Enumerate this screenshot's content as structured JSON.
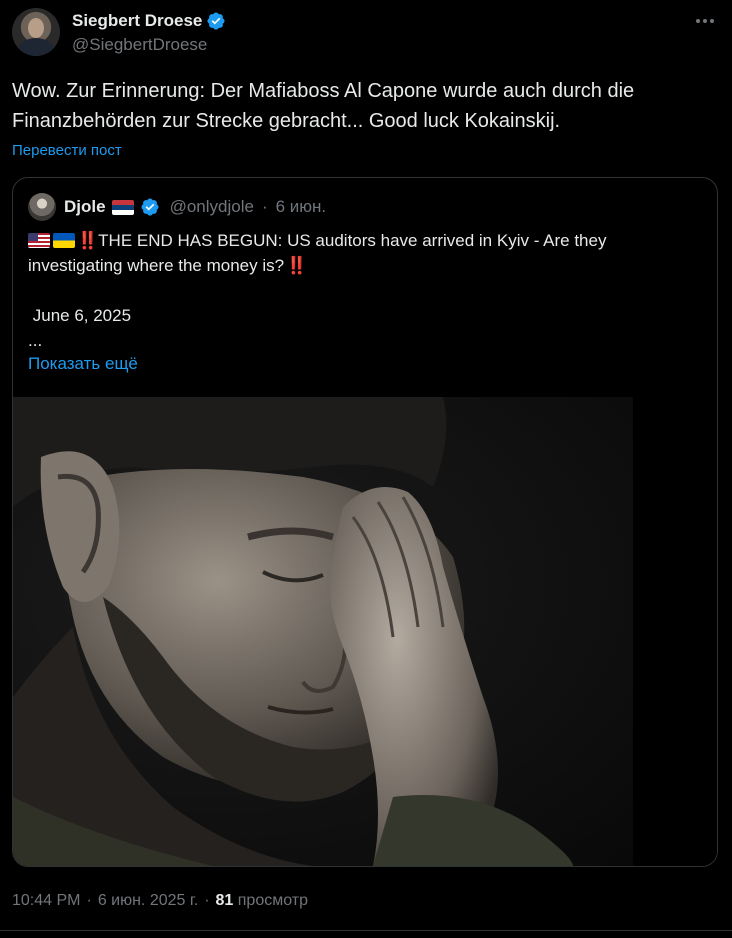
{
  "author": {
    "display_name": "Siegbert Droese",
    "handle": "@SiegbertDroese"
  },
  "tweet": {
    "text_line1": "Wow. Zur Erinnerung: Der Mafiaboss Al Capone wurde auch durch die",
    "text_line2": "Finanzbehörden zur Strecke gebracht... Good luck Kokainskij.",
    "translate_label": "Перевести пост"
  },
  "quote": {
    "display_name": "Djole",
    "handle": "@onlydjole",
    "separator": "·",
    "date": "6 июн.",
    "line1": "THE END HAS BEGUN: US auditors have arrived in Kyiv - Are they",
    "line2": "investigating where the money is?",
    "bang": "‼️",
    "date_line": " June 6, 2025",
    "ellipsis": "...",
    "show_more_label": "Показать ещё"
  },
  "footer": {
    "time": "10:44 PM",
    "dot1": "·",
    "date": "6 июн. 2025 г.",
    "dot2": "·",
    "views_count": "81",
    "views_label": "просмотр"
  },
  "colors": {
    "background": "#000000",
    "text_primary": "#e7e9ea",
    "text_secondary": "#71767b",
    "link": "#1d9bf0",
    "border": "#2f3336",
    "verified": "#1d9bf0"
  },
  "icons": [
    "avatar",
    "verified-badge-icon",
    "more-options-icon",
    "serbia-flag-icon",
    "us-flag-icon",
    "ukraine-flag-icon",
    "double-exclamation-icon"
  ]
}
